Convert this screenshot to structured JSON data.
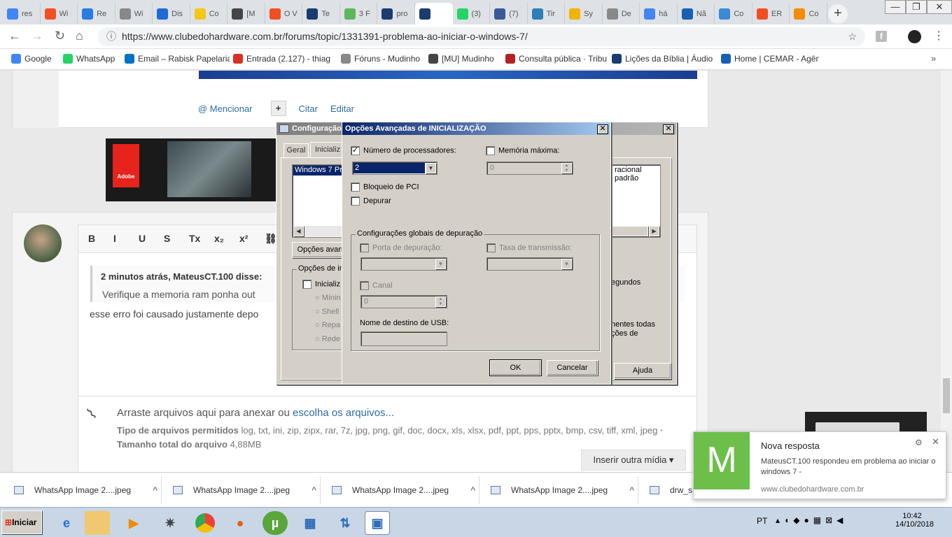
{
  "tabs": [
    {
      "label": "res",
      "icon": "google-icon",
      "color": "#4285f4"
    },
    {
      "label": "Wi",
      "icon": "windows-icon",
      "color": "#f25022"
    },
    {
      "label": "Re",
      "icon": "plus-cross-icon",
      "color": "#2a7be4"
    },
    {
      "label": "Wi",
      "icon": "globe-icon",
      "color": "#888888"
    },
    {
      "label": "Dis",
      "icon": "pen-icon",
      "color": "#1e6bd6"
    },
    {
      "label": "Co",
      "icon": "star-icon",
      "color": "#f5c518"
    },
    {
      "label": "[M",
      "icon": "spider-icon",
      "color": "#444444"
    },
    {
      "label": "O V",
      "icon": "windows-icon",
      "color": "#f25022"
    },
    {
      "label": "Te",
      "icon": "triangle-icon",
      "color": "#1a3c6e"
    },
    {
      "label": "3 F",
      "icon": "h-icon",
      "color": "#5cb85c"
    },
    {
      "label": "pro",
      "icon": "ch-icon",
      "color": "#1a3c6e"
    },
    {
      "label": "",
      "icon": "ch-icon",
      "color": "#1a3c6e"
    },
    {
      "label": "(3)",
      "icon": "whatsapp-icon",
      "color": "#25d366"
    },
    {
      "label": "(7)",
      "icon": "facebook-icon",
      "color": "#3b5998"
    },
    {
      "label": "Tir",
      "icon": "page-icon",
      "color": "#2c7fb8"
    },
    {
      "label": "Sy",
      "icon": "arrow-down-icon",
      "color": "#f0b400"
    },
    {
      "label": "De",
      "icon": "doc-icon",
      "color": "#888888"
    },
    {
      "label": "há",
      "icon": "google-icon",
      "color": "#4285f4"
    },
    {
      "label": "Nã",
      "icon": "pinwheel-icon",
      "color": "#1a5fb4"
    },
    {
      "label": "Co",
      "icon": "screens-icon",
      "color": "#3a8ad6"
    },
    {
      "label": "ER",
      "icon": "windows-icon",
      "color": "#f25022"
    },
    {
      "label": "Co",
      "icon": "tt-icon",
      "color": "#f28c00"
    }
  ],
  "window_controls": {
    "minimize": "—",
    "restore": "❐",
    "close": "✕"
  },
  "address": {
    "url": "https://www.clubedohardware.com.br/forums/topic/1331391-problema-ao-iniciar-o-windows-7/"
  },
  "bookmarks": [
    {
      "label": "Google",
      "icon": "google-icon",
      "color": "#4285f4"
    },
    {
      "label": "WhatsApp",
      "icon": "whatsapp-icon",
      "color": "#25d366"
    },
    {
      "label": "Email – Rabisk Papelaria",
      "icon": "outlook-icon",
      "color": "#0072c6"
    },
    {
      "label": "Entrada (2.127) - thiag",
      "icon": "gmail-icon",
      "color": "#d93025"
    },
    {
      "label": "Fóruns - Mudinho",
      "icon": "doc-icon",
      "color": "#888888"
    },
    {
      "label": "[MU] Mudinho",
      "icon": "spider-icon",
      "color": "#444444"
    },
    {
      "label": "Consulta pública · Tribu",
      "icon": "pje-icon",
      "color": "#b22222"
    },
    {
      "label": "Lições da Bíblia | Áudio",
      "icon": "cup-icon",
      "color": "#1a3c6e"
    },
    {
      "label": "Home | CEMAR - Agênc",
      "icon": "cemar-icon",
      "color": "#1a5fb4"
    }
  ],
  "post": {
    "actions": {
      "mention": "@ Mencionar",
      "plus": "+",
      "quote": "Citar",
      "edit": "Editar"
    },
    "ad_label": "Adobe"
  },
  "editor": {
    "toolbar": [
      "B",
      "I",
      "U",
      "S",
      "Tx",
      "x₂",
      "x²",
      "⛓"
    ],
    "quote_author": "2 minutos atrás, MateusCT.100 disse:",
    "quote_text": "Verifique a memoria ram ponha out",
    "reply_text": "esse erro foi causado justamente depo",
    "attach_text": "Arraste arquivos aqui para anexar ou",
    "attach_link": "escolha os arquivos...",
    "allowed_label": "Tipo de arquivos permitidos",
    "allowed_types": "log, txt, ini, zip, zipx, rar, 7z, jpg, png, gif, doc, docx, xls, xlsx, pdf, ppt, pps, pptx, bmp, csv, tiff, xml, jpeg",
    "size_label": "· Tamanho total do arquivo",
    "size_value": "4,88MB",
    "insert_media": "Inserir outra mídia ▾"
  },
  "config_dialog": {
    "title": "Configuração",
    "tabs": [
      "Geral",
      "Inicializ"
    ],
    "list_item": "Windows 7 Pr",
    "list_item_right": "racional padrão",
    "advanced_btn": "Opções avan",
    "boot_group": "Opções de in",
    "boot_option": "Inicializ",
    "radios": [
      "Mínin",
      "Shell",
      "Repa",
      "Rede"
    ],
    "seconds": "egundos",
    "permanent": "nentes todas",
    "permanent2": "ções de",
    "help_btn": "Ajuda",
    "close": "✕"
  },
  "advanced_dialog": {
    "title": "Opções Avançadas de INICIALIZAÇÃO",
    "num_processors_label": "Número de processadores:",
    "num_processors_checked": true,
    "num_processors_value": "2",
    "max_memory_label": "Memória máxima:",
    "max_memory_value": "0",
    "pci_lock": "Bloqueio de PCI",
    "debug": "Depurar",
    "global_debug_group": "Configurações globais de depuração",
    "debug_port": "Porta de depuração:",
    "baud_rate": "Taxa de transmissão:",
    "channel": "Canal",
    "channel_value": "0",
    "usb_target": "Nome de destino de USB:",
    "ok": "OK",
    "cancel": "Cancelar",
    "close": "✕",
    "check": "✓"
  },
  "downloads": [
    {
      "label": "WhatsApp Image 2....jpeg"
    },
    {
      "label": "WhatsApp Image 2....jpeg"
    },
    {
      "label": "WhatsApp Image 2....jpeg"
    },
    {
      "label": "WhatsApp Image 2....jpeg"
    },
    {
      "label": "drw_s"
    }
  ],
  "notification": {
    "letter": "M",
    "title": "Nova resposta",
    "body": "MateusCT.100 respondeu em problema ao iniciar o windows 7 -",
    "site": "www.clubedohardware.com.br",
    "close": "✕",
    "gear": "⚙",
    "accent": "#6cc04a"
  },
  "taskbar": {
    "start": "Iniciar",
    "lang": "PT",
    "time": "10:42",
    "date": "14/10/2018"
  }
}
